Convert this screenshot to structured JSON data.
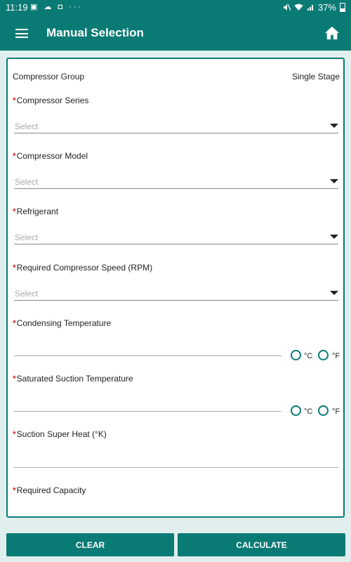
{
  "status_bar": {
    "time": "11:19",
    "notification_icons": "▣ ☁ ◘ ···",
    "battery_percent": "37%",
    "battery_level": 0.37
  },
  "app_bar": {
    "title": "Manual Selection",
    "menu_icon": "hamburger-menu-icon",
    "home_icon": "home-icon"
  },
  "form": {
    "compressor_group": {
      "label": "Compressor Group",
      "value": "Single Stage"
    },
    "required_marker": "*",
    "compressor_series": {
      "label": "Compressor Series",
      "placeholder": "Select"
    },
    "compressor_model": {
      "label": "Compressor Model",
      "placeholder": "Select"
    },
    "refrigerant": {
      "label": "Refrigerant",
      "placeholder": "Select"
    },
    "compressor_speed": {
      "label": "Required Compressor Speed (RPM)",
      "placeholder": "Select"
    },
    "condensing_temperature": {
      "label": "Condensing Temperature",
      "unit_c": "°C",
      "unit_f": "°F"
    },
    "saturated_suction_temperature": {
      "label": "Saturated Suction Temperature",
      "unit_c": "°C",
      "unit_f": "°F"
    },
    "suction_super_heat": {
      "label": "Suction Super Heat (°K)"
    },
    "required_capacity": {
      "label": "Required Capacity"
    }
  },
  "buttons": {
    "clear": "CLEAR",
    "calculate": "CALCULATE"
  },
  "colors": {
    "primary": "#0a7a75",
    "background": "#e0efee",
    "required": "#d32f2f"
  }
}
